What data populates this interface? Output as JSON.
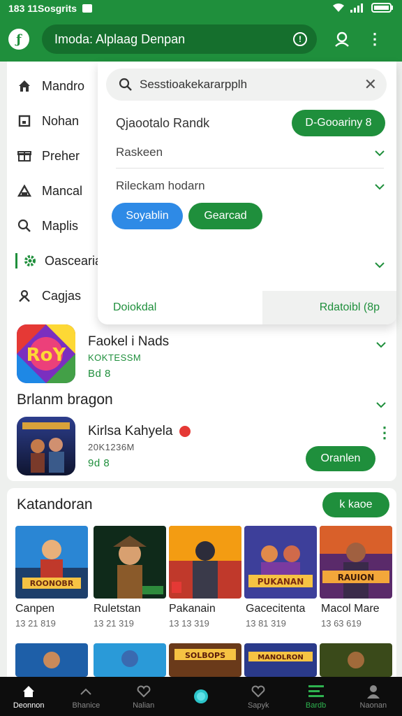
{
  "status_bar": {
    "time": "183 11Sosgrits"
  },
  "app_bar": {
    "search_text": "Imoda: Alplaag Denpan"
  },
  "side_nav": {
    "items": [
      {
        "label": "Mandro",
        "icon": "home-icon"
      },
      {
        "label": "Nohan",
        "icon": "square-icon"
      },
      {
        "label": "Preher",
        "icon": "gift-icon"
      },
      {
        "label": "Mancal",
        "icon": "triangle-icon"
      },
      {
        "label": "Maplis",
        "icon": "search-icon"
      },
      {
        "label": "Oascearia",
        "icon": "gear-icon",
        "active": true
      },
      {
        "label": "Cagjas",
        "icon": "person-icon"
      }
    ]
  },
  "panel": {
    "search_value": "Sesstioakekararpplh",
    "row1_label": "Qjaootalo Randk",
    "row1_button": "D-Gooariny 8",
    "row2_label": "Raskeen",
    "row3_label": "Rileckam hodarn",
    "chip_blue": "Soyablin",
    "chip_green": "Gearcad",
    "footer_left": "Doiokdal",
    "footer_right": "Rdatoibl (8p"
  },
  "apps": [
    {
      "title": "Faokel i Nads",
      "sub1": "KOKTESSM",
      "sub2": "Bd 8"
    },
    {
      "title": "Kirlsa Kahyela",
      "sub1": "20K1236M",
      "sub2": "9d 8",
      "button": "Oranlen"
    }
  ],
  "section_heading": "Brlanm bragon",
  "categories": {
    "title": "Katandoran",
    "button": "k kaoe",
    "tiles": [
      {
        "name": "Canpen",
        "sub": "13 21 819",
        "caption": "ROONOBR"
      },
      {
        "name": "Ruletstan",
        "sub": "13 21 319",
        "caption": ""
      },
      {
        "name": "Pakanain",
        "sub": "13 13 319",
        "caption": ""
      },
      {
        "name": "Gacecitenta",
        "sub": "13 81 319",
        "caption": "PUKANAN"
      },
      {
        "name": "Macol Mare",
        "sub": "13 63 619",
        "caption": "RAUION"
      }
    ],
    "row2_captions": [
      "",
      "",
      "SOLBOPS",
      "MANOLRON",
      ""
    ]
  },
  "bottom_nav": {
    "items": [
      {
        "label": "Deonnon",
        "icon": "home-icon",
        "active": true
      },
      {
        "label": "Bhanice",
        "icon": "chevron-up-icon"
      },
      {
        "label": "Nalian",
        "icon": "heart-icon"
      },
      {
        "label": "",
        "icon": "circle-icon"
      },
      {
        "label": "Sapyk",
        "icon": "heart-outline-icon"
      },
      {
        "label": "Bardb",
        "icon": "bars-icon"
      },
      {
        "label": "Naonan",
        "icon": "person-icon"
      }
    ]
  }
}
